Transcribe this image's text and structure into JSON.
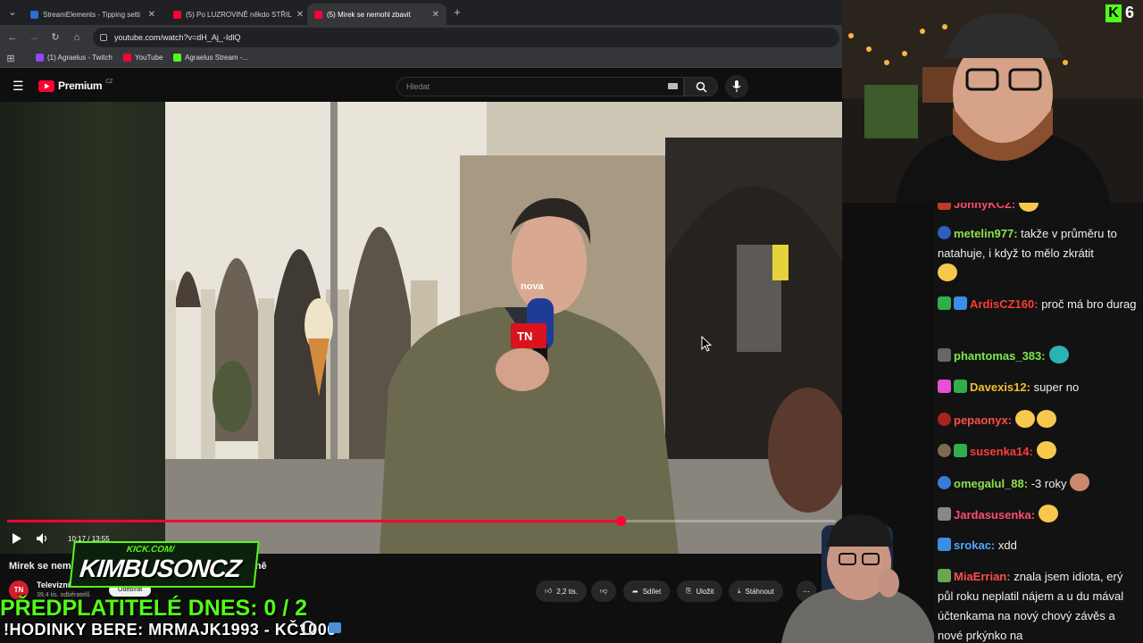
{
  "browser": {
    "tabs": [
      {
        "label": "StreamElements - Tipping setti",
        "color": "#2a6fd6",
        "active": false
      },
      {
        "label": "(5) Po LUZROVINĚ někdo STŘIL",
        "color": "#ff0033",
        "active": false
      },
      {
        "label": "(5) Mirek se nemohl zbavit",
        "color": "#ff0033",
        "active": true
      }
    ],
    "add_tab": "+",
    "url": "youtube.com/watch?v=dH_Aj_-IdlQ",
    "bookmarks": [
      {
        "label": "(1) Agraelus - Twitch",
        "color": "#9146ff"
      },
      {
        "label": "YouTube",
        "color": "#ff0033"
      },
      {
        "label": "Agraelus Stream -...",
        "color": "#53fc18"
      }
    ]
  },
  "youtube": {
    "logo_text": "Premium",
    "logo_region": "CZ",
    "search_placeholder": "Hledat",
    "time": "10:17 / 13:55",
    "progress_fraction": 0.74,
    "video_title": "Mirek se nem… ě ho čekalo překvapení | Na vaší straně",
    "channel_badge": "TN",
    "channel_name": "Televizní",
    "subscribers": "39,4 tis. odběratelů",
    "subscribe_label": "Odebírat",
    "likes": "2,2 tis.",
    "share_label": "Sdílet",
    "save_label": "Uložit",
    "download_label": "Stáhnout"
  },
  "video_overlay": {
    "mic_logo": "nova",
    "cube_logo": "TN"
  },
  "overlay": {
    "kick_url": "KICK.COM/",
    "kick_name": "KIMBUSONCZ",
    "sub_goal": "PŘEDPLATITELÉ DNES: 0 / 2",
    "hours_line": "!HODINKY BERE: MRMAJK1993 - KČ1000"
  },
  "viewer_badge": {
    "icon": "K",
    "count": "6"
  },
  "chat": [
    {
      "user": "JonnyKCZ:",
      "color": "#ff4d6d",
      "text": "",
      "badge": "#c0392b",
      "emote": true
    },
    {
      "user": "metelin977:",
      "color": "#8ee04e",
      "text": "takže v průměru to natahuje, i když to mělo zkrátit",
      "badge": "#2d5fbf",
      "emote": true
    },
    {
      "user": "ArdisCZ160:",
      "color": "#ff3b3b",
      "text": "proč má bro durag",
      "badge": "#2fae4a",
      "emote": false
    },
    {
      "user": "phantomas_383:",
      "color": "#7ee84e",
      "text": "",
      "badge": "#666666",
      "emote": true
    },
    {
      "user": "Davexis12:",
      "color": "#f0c02a",
      "text": "super no",
      "badge": "#e84fd6",
      "emote": false
    },
    {
      "user": "pepaonyx:",
      "color": "#ff4d4d",
      "text": "",
      "badge": "#aa2222",
      "emote": true
    },
    {
      "user": "susenka14:",
      "color": "#ff3b3b",
      "text": "",
      "badge": "#7c6b4f",
      "emote": true
    },
    {
      "user": "omegalul_88:",
      "color": "#8ee04e",
      "text": "-3 roky",
      "badge": "#3a7bd5",
      "emote": true
    },
    {
      "user": "Jardasusenka:",
      "color": "#ff4d6d",
      "text": "",
      "badge": "#888888",
      "emote": true
    },
    {
      "user": "srokac:",
      "color": "#4fa8ff",
      "text": "xdd",
      "badge": "#3a8ee6",
      "emote": false
    },
    {
      "user": "MiaErrian:",
      "color": "#ff4d4d",
      "text": "znala jsem idiota, erý půl roku neplatil nájem a u du mával účtenkama na nový chový závěs a nové prkýnko na",
      "badge": "#6aa84f",
      "emote": false
    }
  ]
}
